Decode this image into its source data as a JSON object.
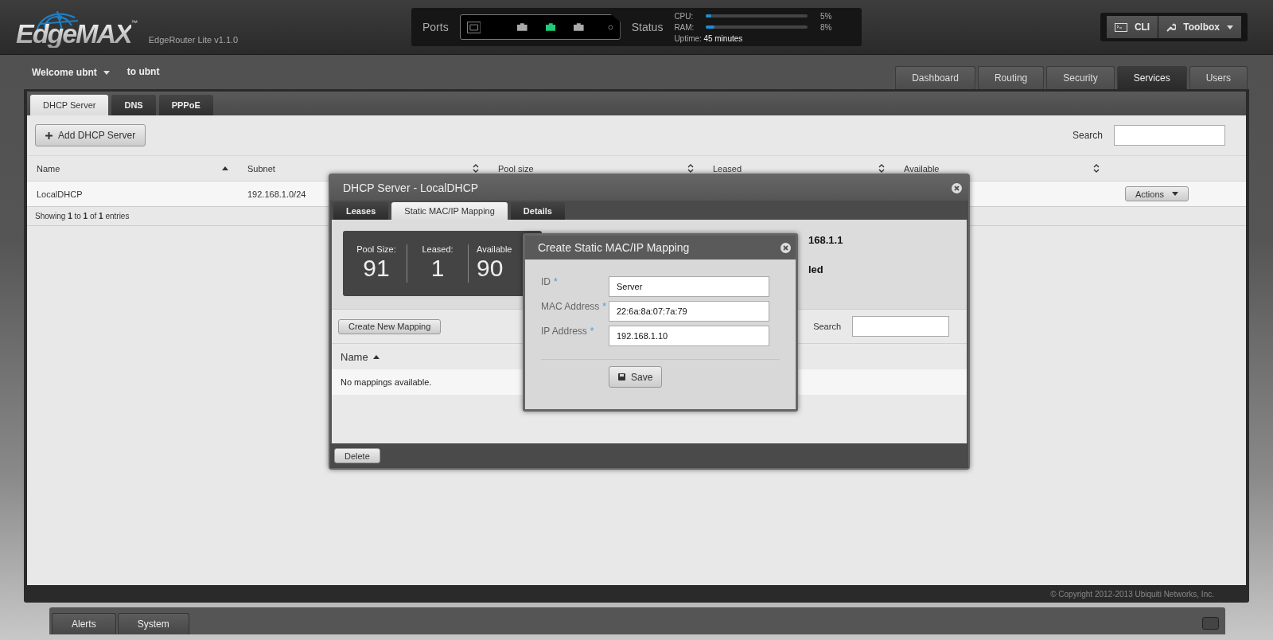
{
  "header": {
    "logo": "EdgeMAX",
    "logo_mark": "™",
    "product": "EdgeRouter Lite v1.1.0",
    "ports_label": "Ports",
    "ports": [
      {
        "kind": "console"
      },
      {
        "kind": "eth",
        "active": false
      },
      {
        "kind": "eth",
        "active": true
      },
      {
        "kind": "eth",
        "active": false
      },
      {
        "kind": "led"
      }
    ],
    "status_label": "Status",
    "meters": [
      {
        "label": "CPU:",
        "level": 0.05,
        "reading": "5%"
      },
      {
        "label": "RAM:",
        "level": 0.08,
        "reading": "8%"
      }
    ],
    "uptime_label": "Uptime:",
    "uptime": "45 minutes",
    "tools": [
      {
        "label": "CLI",
        "dropdown": false
      },
      {
        "label": "Toolbox",
        "dropdown": true
      }
    ]
  },
  "user_bar": {
    "welcome": "Welcome ubnt",
    "target": "to ubnt"
  },
  "nav_tabs": [
    {
      "label": "Dashboard",
      "selected": false
    },
    {
      "label": "Routing",
      "selected": false
    },
    {
      "label": "Security",
      "selected": false
    },
    {
      "label": "Services",
      "selected": true
    },
    {
      "label": "Users",
      "selected": false
    }
  ],
  "sub_tabs": [
    {
      "label": "DHCP Server",
      "selected": true
    },
    {
      "label": "DNS",
      "selected": false
    },
    {
      "label": "PPPoE",
      "selected": false
    }
  ],
  "add_button": "Add DHCP Server",
  "search_label": "Search",
  "table": {
    "columns": [
      {
        "label": "Name",
        "sorted": true
      },
      {
        "label": "Subnet",
        "sorted": false
      },
      {
        "label": "Pool size",
        "sorted": false
      },
      {
        "label": "Leased",
        "sorted": false
      },
      {
        "label": "Available",
        "sorted": false
      }
    ],
    "rows": [
      {
        "cells": [
          "LocalDHCP",
          "192.168.1.0/24"
        ],
        "action": "Actions"
      }
    ],
    "info": "Showing **1** to **1** of **1** entries"
  },
  "footer": {
    "copyright": "© Copyright 2012-2013 Ubiquiti Networks, Inc."
  },
  "bottom_tabs": [
    "Alerts",
    "System"
  ],
  "dhcp_dialog": {
    "title": "DHCP Server - LocalDHCP",
    "tabs": [
      {
        "label": "Leases",
        "selected": false
      },
      {
        "label": "Static MAC/IP Mapping",
        "selected": true
      },
      {
        "label": "Details",
        "selected": false
      }
    ],
    "stats": [
      {
        "label": "Pool Size:",
        "value": "91"
      },
      {
        "label": "Leased:",
        "value": "1"
      },
      {
        "label": "Available",
        "value": "90"
      }
    ],
    "detail_fragments": [
      "168.1.1",
      "led"
    ],
    "create_button": "Create New Mapping",
    "search_label": "Search",
    "column": {
      "label": "Name",
      "sorted": true
    },
    "empty": "No mappings available.",
    "delete_button": "Delete"
  },
  "mapping_dialog": {
    "title": "Create Static MAC/IP Mapping",
    "fields": [
      {
        "label": "ID",
        "required_mark": "*",
        "value": "Server"
      },
      {
        "label": "MAC Address",
        "required_mark": "*",
        "value": "22:6a:8a:07:7a:79"
      },
      {
        "label": "IP Address",
        "required_mark": "*",
        "value": "192.168.1.10"
      }
    ],
    "save_button": "Save"
  }
}
